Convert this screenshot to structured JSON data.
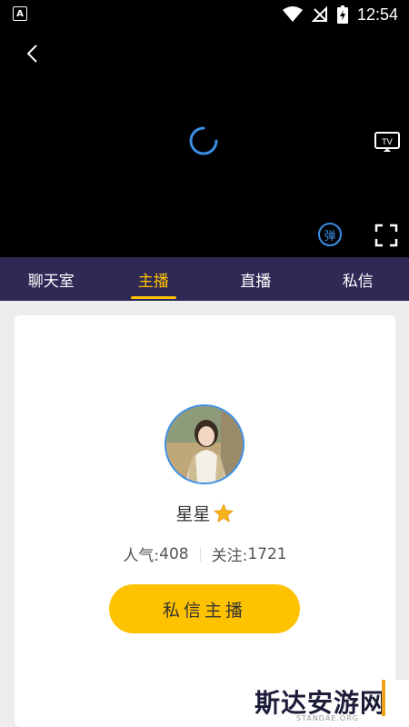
{
  "status_bar": {
    "app_badge": "A",
    "time": "12:54"
  },
  "video": {
    "danmu_label": "弹"
  },
  "tabs": [
    {
      "label": "聊天室",
      "active": false
    },
    {
      "label": "主播",
      "active": true
    },
    {
      "label": "直播",
      "active": false
    },
    {
      "label": "私信",
      "active": false
    }
  ],
  "profile": {
    "name": "星星",
    "popularity_label": "人气:",
    "popularity_value": "408",
    "follow_label": "关注:",
    "follow_value": "1721",
    "message_button": "私信主播"
  },
  "watermark": {
    "text": "斯达安游网",
    "sub": "STANDAE.ORG"
  },
  "colors": {
    "accent": "#ffc000",
    "tab_bg": "#2e2a55",
    "link_blue": "#3a8ee6"
  }
}
